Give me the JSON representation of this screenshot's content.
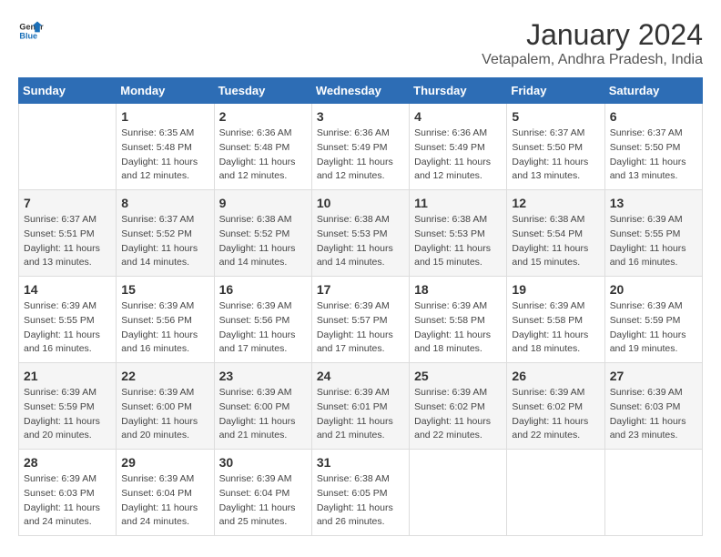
{
  "logo": {
    "text_general": "General",
    "text_blue": "Blue"
  },
  "title": "January 2024",
  "location": "Vetapalem, Andhra Pradesh, India",
  "headers": [
    "Sunday",
    "Monday",
    "Tuesday",
    "Wednesday",
    "Thursday",
    "Friday",
    "Saturday"
  ],
  "weeks": [
    [
      {
        "day": "",
        "info": ""
      },
      {
        "day": "1",
        "info": "Sunrise: 6:35 AM\nSunset: 5:48 PM\nDaylight: 11 hours\nand 12 minutes."
      },
      {
        "day": "2",
        "info": "Sunrise: 6:36 AM\nSunset: 5:48 PM\nDaylight: 11 hours\nand 12 minutes."
      },
      {
        "day": "3",
        "info": "Sunrise: 6:36 AM\nSunset: 5:49 PM\nDaylight: 11 hours\nand 12 minutes."
      },
      {
        "day": "4",
        "info": "Sunrise: 6:36 AM\nSunset: 5:49 PM\nDaylight: 11 hours\nand 12 minutes."
      },
      {
        "day": "5",
        "info": "Sunrise: 6:37 AM\nSunset: 5:50 PM\nDaylight: 11 hours\nand 13 minutes."
      },
      {
        "day": "6",
        "info": "Sunrise: 6:37 AM\nSunset: 5:50 PM\nDaylight: 11 hours\nand 13 minutes."
      }
    ],
    [
      {
        "day": "7",
        "info": "Sunrise: 6:37 AM\nSunset: 5:51 PM\nDaylight: 11 hours\nand 13 minutes."
      },
      {
        "day": "8",
        "info": "Sunrise: 6:37 AM\nSunset: 5:52 PM\nDaylight: 11 hours\nand 14 minutes."
      },
      {
        "day": "9",
        "info": "Sunrise: 6:38 AM\nSunset: 5:52 PM\nDaylight: 11 hours\nand 14 minutes."
      },
      {
        "day": "10",
        "info": "Sunrise: 6:38 AM\nSunset: 5:53 PM\nDaylight: 11 hours\nand 14 minutes."
      },
      {
        "day": "11",
        "info": "Sunrise: 6:38 AM\nSunset: 5:53 PM\nDaylight: 11 hours\nand 15 minutes."
      },
      {
        "day": "12",
        "info": "Sunrise: 6:38 AM\nSunset: 5:54 PM\nDaylight: 11 hours\nand 15 minutes."
      },
      {
        "day": "13",
        "info": "Sunrise: 6:39 AM\nSunset: 5:55 PM\nDaylight: 11 hours\nand 16 minutes."
      }
    ],
    [
      {
        "day": "14",
        "info": "Sunrise: 6:39 AM\nSunset: 5:55 PM\nDaylight: 11 hours\nand 16 minutes."
      },
      {
        "day": "15",
        "info": "Sunrise: 6:39 AM\nSunset: 5:56 PM\nDaylight: 11 hours\nand 16 minutes."
      },
      {
        "day": "16",
        "info": "Sunrise: 6:39 AM\nSunset: 5:56 PM\nDaylight: 11 hours\nand 17 minutes."
      },
      {
        "day": "17",
        "info": "Sunrise: 6:39 AM\nSunset: 5:57 PM\nDaylight: 11 hours\nand 17 minutes."
      },
      {
        "day": "18",
        "info": "Sunrise: 6:39 AM\nSunset: 5:58 PM\nDaylight: 11 hours\nand 18 minutes."
      },
      {
        "day": "19",
        "info": "Sunrise: 6:39 AM\nSunset: 5:58 PM\nDaylight: 11 hours\nand 18 minutes."
      },
      {
        "day": "20",
        "info": "Sunrise: 6:39 AM\nSunset: 5:59 PM\nDaylight: 11 hours\nand 19 minutes."
      }
    ],
    [
      {
        "day": "21",
        "info": "Sunrise: 6:39 AM\nSunset: 5:59 PM\nDaylight: 11 hours\nand 20 minutes."
      },
      {
        "day": "22",
        "info": "Sunrise: 6:39 AM\nSunset: 6:00 PM\nDaylight: 11 hours\nand 20 minutes."
      },
      {
        "day": "23",
        "info": "Sunrise: 6:39 AM\nSunset: 6:00 PM\nDaylight: 11 hours\nand 21 minutes."
      },
      {
        "day": "24",
        "info": "Sunrise: 6:39 AM\nSunset: 6:01 PM\nDaylight: 11 hours\nand 21 minutes."
      },
      {
        "day": "25",
        "info": "Sunrise: 6:39 AM\nSunset: 6:02 PM\nDaylight: 11 hours\nand 22 minutes."
      },
      {
        "day": "26",
        "info": "Sunrise: 6:39 AM\nSunset: 6:02 PM\nDaylight: 11 hours\nand 22 minutes."
      },
      {
        "day": "27",
        "info": "Sunrise: 6:39 AM\nSunset: 6:03 PM\nDaylight: 11 hours\nand 23 minutes."
      }
    ],
    [
      {
        "day": "28",
        "info": "Sunrise: 6:39 AM\nSunset: 6:03 PM\nDaylight: 11 hours\nand 24 minutes."
      },
      {
        "day": "29",
        "info": "Sunrise: 6:39 AM\nSunset: 6:04 PM\nDaylight: 11 hours\nand 24 minutes."
      },
      {
        "day": "30",
        "info": "Sunrise: 6:39 AM\nSunset: 6:04 PM\nDaylight: 11 hours\nand 25 minutes."
      },
      {
        "day": "31",
        "info": "Sunrise: 6:38 AM\nSunset: 6:05 PM\nDaylight: 11 hours\nand 26 minutes."
      },
      {
        "day": "",
        "info": ""
      },
      {
        "day": "",
        "info": ""
      },
      {
        "day": "",
        "info": ""
      }
    ]
  ]
}
